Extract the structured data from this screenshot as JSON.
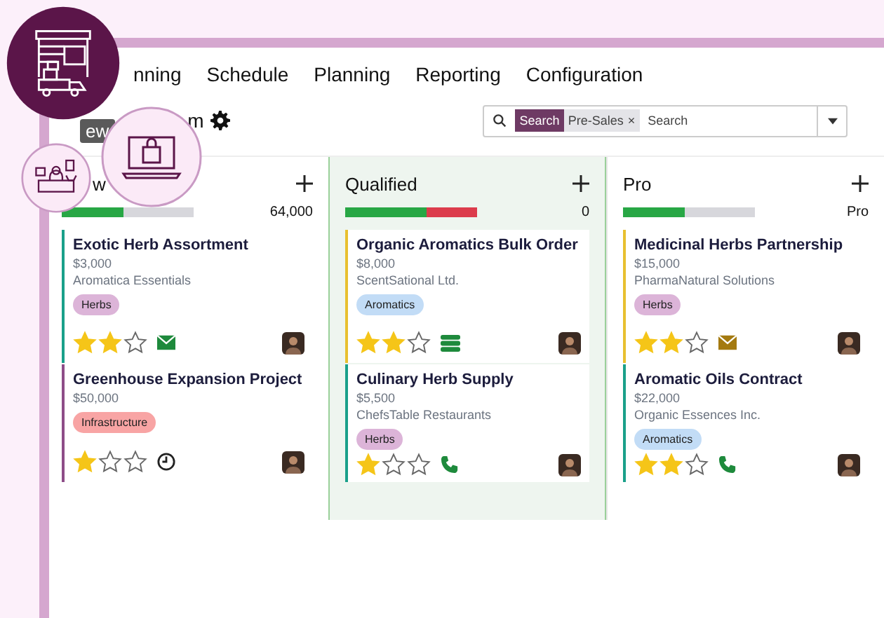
{
  "nav": {
    "items": [
      "nning",
      "Schedule",
      "Planning",
      "Reporting",
      "Configuration"
    ]
  },
  "control_bar": {
    "button": "ew",
    "title": "m",
    "search": {
      "facet_label": "Search",
      "facet_value": "Pre-Sales",
      "facet_remove": "×",
      "placeholder": "Search"
    }
  },
  "columns": [
    {
      "title": "w",
      "total": "64,000",
      "tinted": false,
      "segments": [
        {
          "color": "#28a745",
          "level": 0.47
        },
        {
          "color": "#d7d7dc",
          "level": 0.53
        }
      ],
      "cards": [
        {
          "name": "Exotic Herb Assortment",
          "amount": "$3,000",
          "company": "Aromatica Essentials",
          "tag": {
            "label": "Herbs",
            "color": "#dcb4d8"
          },
          "stars": 2,
          "activity": {
            "kind": "email",
            "color": "#1e8a3c"
          },
          "color": "#1aa08a"
        },
        {
          "name": "Greenhouse Expansion Project",
          "amount": "$50,000",
          "tag": {
            "label": "Infrastructure",
            "color": "#f8a4a4"
          },
          "stars": 1,
          "activity": {
            "kind": "clock",
            "color": "#222222"
          },
          "color": "#8e4d88"
        }
      ]
    },
    {
      "title": "Qualified",
      "total": "0",
      "tinted": true,
      "segments": [
        {
          "color": "#28a745",
          "level": 0.62
        },
        {
          "color": "#dc3c4c",
          "level": 0.38
        }
      ],
      "cards": [
        {
          "name": "Organic Aromatics Bulk Order",
          "amount": "$8,000",
          "company": "ScentSational Ltd.",
          "tag": {
            "label": "Aromatics",
            "color": "#c2dcf6"
          },
          "stars": 2,
          "activity": {
            "kind": "stack",
            "color": "#1e8a3c"
          },
          "color": "#e8c030"
        },
        {
          "name": "Culinary Herb Supply",
          "amount": "$5,500",
          "company": "ChefsTable Restaurants",
          "tag": {
            "label": "Herbs",
            "color": "#dcb4d8"
          },
          "stars": 1,
          "activity": {
            "kind": "phone",
            "color": "#1e8a3c"
          },
          "color": "#1aa08a"
        }
      ]
    },
    {
      "title": "Pro",
      "total": "Pro",
      "tinted": false,
      "segments": [
        {
          "color": "#28a745",
          "level": 0.47
        },
        {
          "color": "#d7d7dc",
          "level": 0.53
        }
      ],
      "cards": [
        {
          "name": "Medicinal Herbs Partnership",
          "amount": "$15,000",
          "company": "PharmaNatural Solutions",
          "tag": {
            "label": "Herbs",
            "color": "#dcb4d8"
          },
          "stars": 2,
          "activity": {
            "kind": "email",
            "color": "#a47a10"
          },
          "color": "#e8c030"
        },
        {
          "name": "Aromatic Oils Contract",
          "amount": "$22,000",
          "company": "Organic Essences Inc.",
          "tag": {
            "label": "Aromatics",
            "color": "#c2dcf6"
          },
          "stars": 2,
          "activity": {
            "kind": "phone",
            "color": "#1e8a3c"
          },
          "color": "#1aa08a"
        }
      ]
    }
  ]
}
